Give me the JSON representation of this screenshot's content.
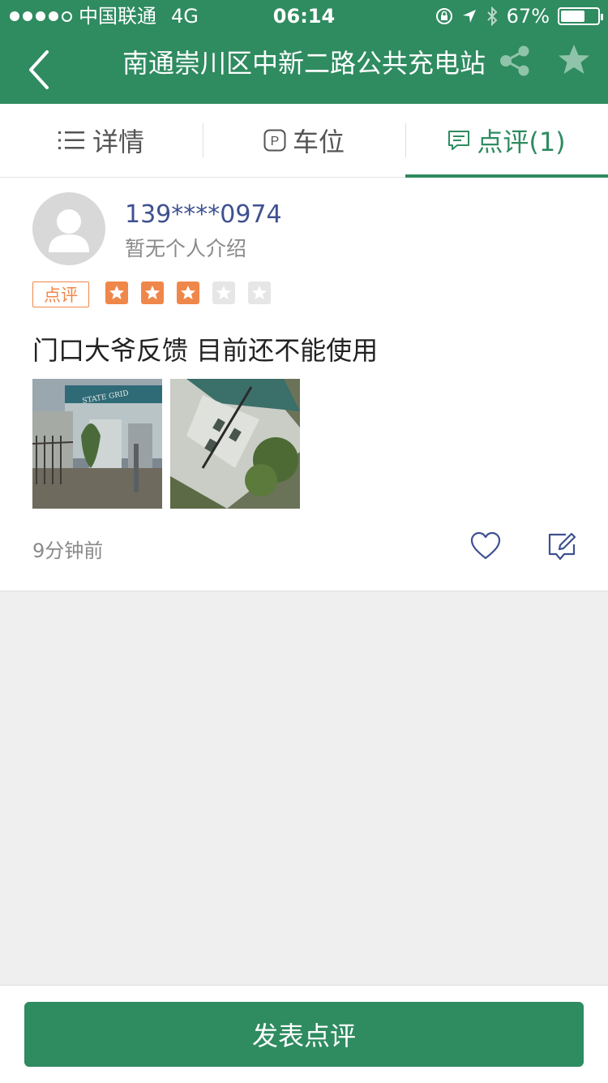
{
  "status_bar": {
    "carrier": "中国联通",
    "network": "4G",
    "time": "06:14",
    "battery": "67%",
    "battery_level": 0.67
  },
  "nav": {
    "title": "南通崇川区中新二路公共充电站"
  },
  "tabs": [
    {
      "label": "详情",
      "icon": "list-icon"
    },
    {
      "label": "车位",
      "icon": "parking-icon"
    },
    {
      "label": "点评(1)",
      "icon": "comment-icon",
      "active": true
    }
  ],
  "review": {
    "user": "139****0974",
    "bio": "暂无个人介绍",
    "tag": "点评",
    "rating": 3,
    "rating_max": 5,
    "text": "门口大爷反馈 目前还不能使用",
    "time_ago": "9分钟前",
    "photos": [
      "charging-station-gate-photo",
      "charging-station-tilted-photo"
    ]
  },
  "footer": {
    "button_label": "发表点评"
  },
  "colors": {
    "primary": "#2f8b60",
    "accent": "#f0874a",
    "link": "#3f5190"
  }
}
